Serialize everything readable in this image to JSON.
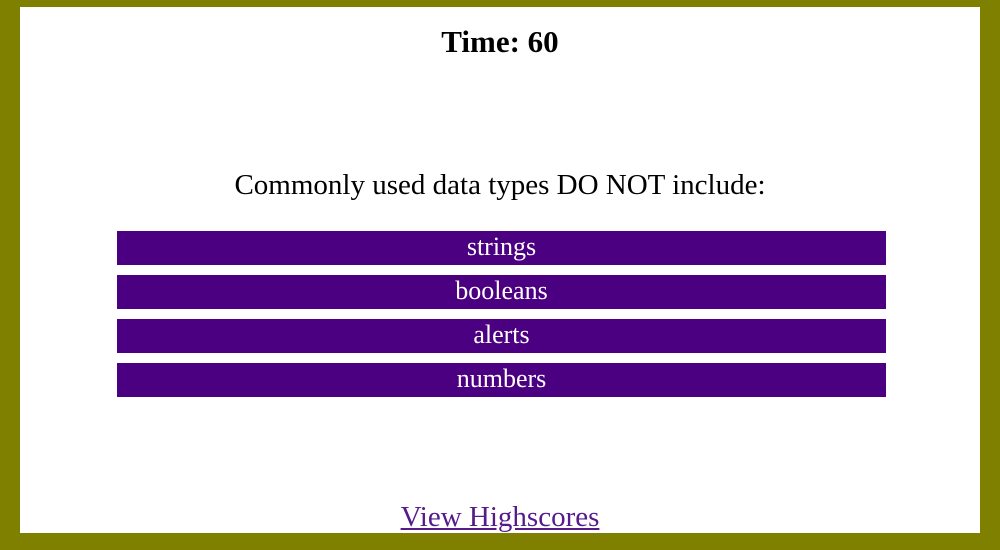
{
  "timer": {
    "label": "Time: 60"
  },
  "quiz": {
    "question": "Commonly used data types DO NOT include:",
    "choices": [
      "strings",
      "booleans",
      "alerts",
      "numbers"
    ]
  },
  "footer": {
    "highscores_link": "View Highscores"
  },
  "colors": {
    "border": "#808000",
    "choice_background": "#4b0082",
    "choice_text": "#ffffff",
    "link": "#551a8b"
  }
}
